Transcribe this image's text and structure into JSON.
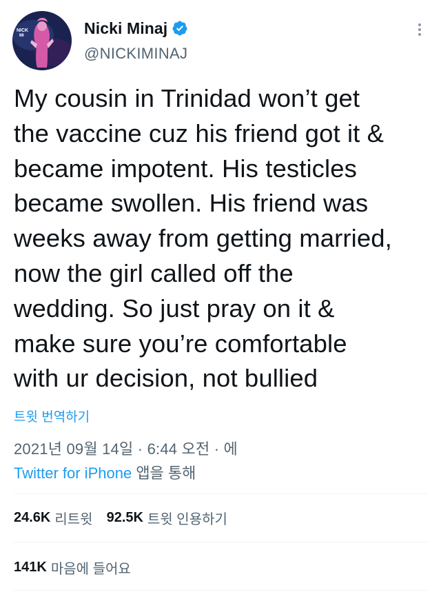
{
  "author": {
    "display_name": "Nicki Minaj",
    "handle": "@NICKIMINAJ",
    "verified": true,
    "avatar_icon": "profile-avatar",
    "verified_color": "#1d9bf0"
  },
  "menu": {
    "icon": "more-options-icon"
  },
  "tweet": {
    "text": "My cousin in Trinidad won’t get\nthe vaccine cuz his friend got it &\nbecame impotent. His testicles\nbecame swollen. His friend was\nweeks away from getting married,\nnow the girl called off the\nwedding. So just pray on it &\nmake sure you’re comfortable\nwith ur decision, not bullied",
    "translate_label": "트윗 번역하기",
    "timestamp": "2021년 09월 14일 · 6:44 오전 · 에",
    "source_app": "Twitter for iPhone",
    "source_suffix": "앱을 통해"
  },
  "stats": {
    "retweets_count": "24.6K",
    "retweets_label": "리트윗",
    "quotes_count": "92.5K",
    "quotes_label": "트윗 인용하기",
    "likes_count": "141K",
    "likes_label": "마음에 들어요"
  },
  "colors": {
    "link": "#1d9bf0",
    "secondary_text": "#536471",
    "primary_text": "#0f1419",
    "divider": "#eff3f4"
  }
}
